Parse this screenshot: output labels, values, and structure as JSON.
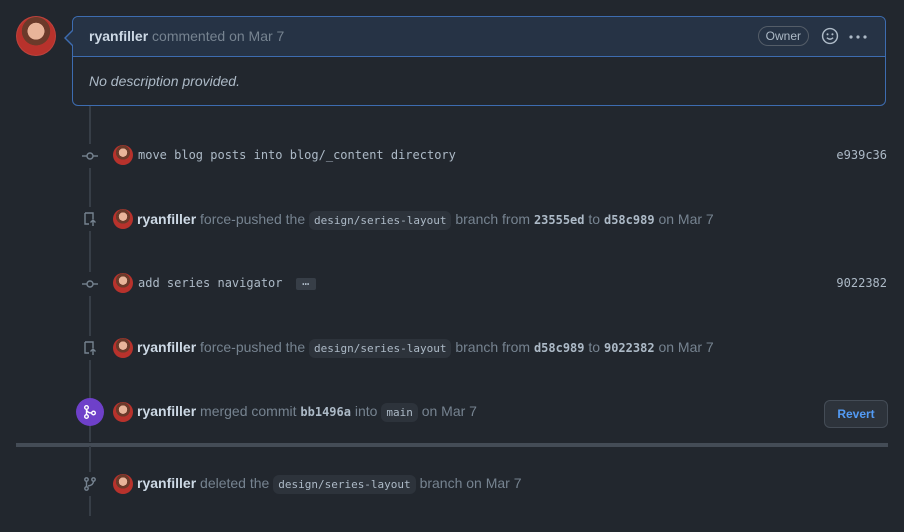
{
  "comment": {
    "author": "ryanfiller",
    "action": "commented on Mar 7",
    "badge": "Owner",
    "body": "No description provided."
  },
  "timeline": [
    {
      "type": "commit",
      "message": "move blog posts into blog/_content directory",
      "sha": "e939c36"
    },
    {
      "type": "force-push",
      "author": "ryanfiller",
      "text1": "force-pushed the",
      "branch": "design/series-layout",
      "text2": "branch from",
      "from": "23555ed",
      "text3": "to",
      "to": "d58c989",
      "date": "on Mar 7"
    },
    {
      "type": "commit",
      "message": "add series navigator",
      "sha": "9022382"
    },
    {
      "type": "force-push",
      "author": "ryanfiller",
      "text1": "force-pushed the",
      "branch": "design/series-layout",
      "text2": "branch from",
      "from": "d58c989",
      "text3": "to",
      "to": "9022382",
      "date": "on Mar 7"
    },
    {
      "type": "merge",
      "author": "ryanfiller",
      "text1": "merged commit",
      "commit": "bb1496a",
      "text2": "into",
      "branch": "main",
      "date": "on Mar 7",
      "button": "Revert"
    },
    {
      "type": "delete",
      "author": "ryanfiller",
      "text1": "deleted the",
      "branch": "design/series-layout",
      "text2": "branch",
      "date": "on Mar 7"
    }
  ],
  "colors": {
    "background": "#22272e",
    "accent_blue": "#539bf5",
    "merged_purple": "#6e40c9",
    "border_blue": "#3d6cb0"
  },
  "icons": [
    "emoji-smiley-icon",
    "kebab-horizontal-icon",
    "git-commit-icon",
    "repo-push-icon",
    "git-merge-icon",
    "git-branch-icon"
  ]
}
